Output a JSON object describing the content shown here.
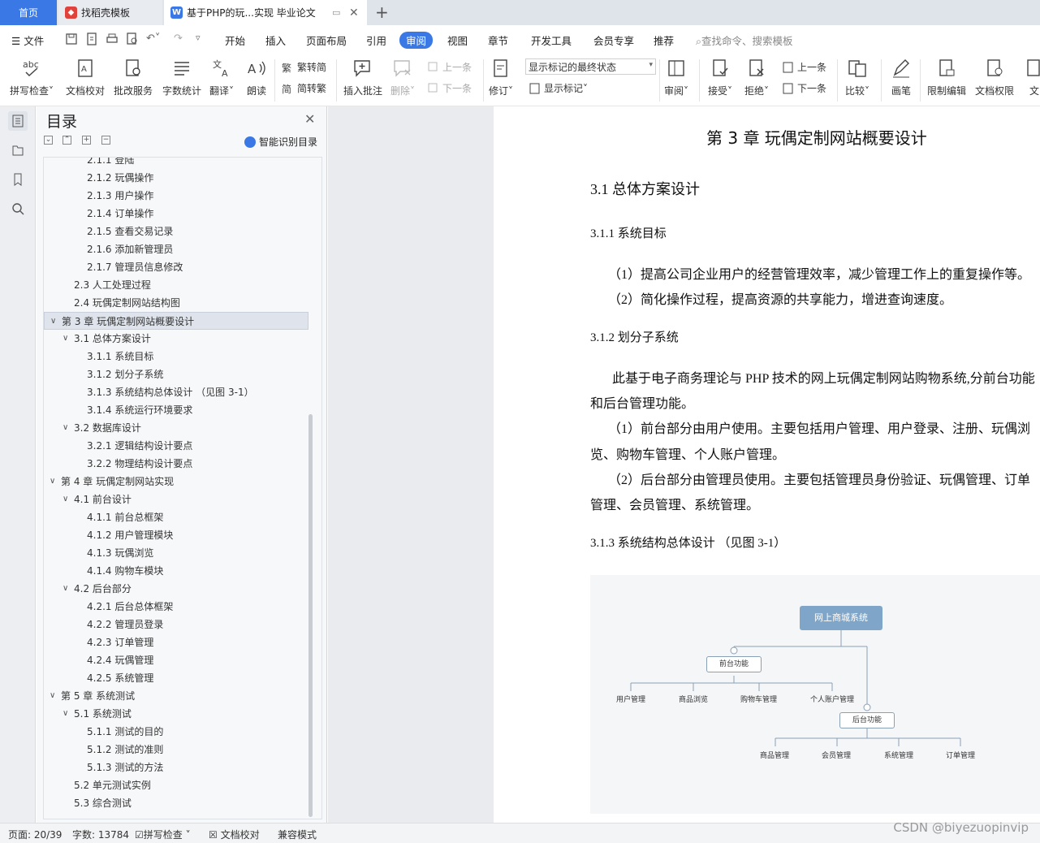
{
  "tabs": [
    {
      "label": "首页"
    },
    {
      "label": "找稻壳模板"
    },
    {
      "label": "基于PHP的玩...实现 毕业论文"
    }
  ],
  "menubar": {
    "file": "文件",
    "items": [
      "开始",
      "插入",
      "页面布局",
      "引用",
      "审阅",
      "视图",
      "章节",
      "开发工具",
      "会员专享",
      "推荐"
    ],
    "active": "审阅",
    "search_placeholder": "查找命令、搜索模板"
  },
  "ribbon": {
    "spell": "拼写检查",
    "proofread": "文档校对",
    "annotate_service": "批改服务",
    "wordcount": "字数统计",
    "translate": "翻译",
    "read_aloud": "朗读",
    "to_traditional": "繁转简",
    "to_simplified": "简转繁",
    "insert_comment": "插入批注",
    "delete": "删除",
    "prev_comment": "上一条",
    "next_comment": "下一条",
    "track": "修订",
    "markup_select": "显示标记的最终状态",
    "show_markup": "显示标记",
    "review": "审阅",
    "accept": "接受",
    "reject": "拒绝",
    "prev_change": "上一条",
    "next_change": "下一条",
    "compare": "比较",
    "pen": "画笔",
    "restrict": "限制编辑",
    "permission": "文档权限",
    "more": "文"
  },
  "nav": {
    "title": "目录",
    "smart": "智能识别目录",
    "items": [
      {
        "label": "2.1.1 登陆",
        "level": 3
      },
      {
        "label": "2.1.2 玩偶操作",
        "level": 3
      },
      {
        "label": "2.1.3 用户操作",
        "level": 3
      },
      {
        "label": "2.1.4 订单操作",
        "level": 3
      },
      {
        "label": "2.1.5 查看交易记录",
        "level": 3
      },
      {
        "label": "2.1.6 添加新管理员",
        "level": 3
      },
      {
        "label": "2.1.7 管理员信息修改",
        "level": 3
      },
      {
        "label": "2.3 人工处理过程",
        "level": 2
      },
      {
        "label": "2.4 玩偶定制网站结构图",
        "level": 2
      },
      {
        "label": "第 3 章  玩偶定制网站概要设计",
        "level": 1,
        "selected": true
      },
      {
        "label": "3.1 总体方案设计",
        "level": 2
      },
      {
        "label": "3.1.1  系统目标",
        "level": 3
      },
      {
        "label": "3.1.2  划分子系统",
        "level": 3
      },
      {
        "label": "3.1.3  系统结构总体设计  （见图 3-1）",
        "level": 3
      },
      {
        "label": "3.1.4  系统运行环境要求",
        "level": 3
      },
      {
        "label": "3.2  数据库设计",
        "level": 2
      },
      {
        "label": "3.2.1 逻辑结构设计要点",
        "level": 3
      },
      {
        "label": "3.2.2 物理结构设计要点",
        "level": 3
      },
      {
        "label": "第 4 章  玩偶定制网站实现",
        "level": 1
      },
      {
        "label": "4.1  前台设计",
        "level": 2
      },
      {
        "label": "4.1.1  前台总框架",
        "level": 3
      },
      {
        "label": "4.1.2  用户管理模块",
        "level": 3
      },
      {
        "label": "4.1.3  玩偶浏览",
        "level": 3
      },
      {
        "label": "4.1.4  购物车模块",
        "level": 3
      },
      {
        "label": "4.2  后台部分",
        "level": 2
      },
      {
        "label": "4.2.1  后台总体框架",
        "level": 3
      },
      {
        "label": "4.2.2  管理员登录",
        "level": 3
      },
      {
        "label": "4.2.3  订单管理",
        "level": 3
      },
      {
        "label": "4.2.4  玩偶管理",
        "level": 3
      },
      {
        "label": "4.2.5  系统管理",
        "level": 3
      },
      {
        "label": "第 5 章  系统测试",
        "level": 1
      },
      {
        "label": "5.1 系统测试",
        "level": 2
      },
      {
        "label": "5.1.1 测试的目的",
        "level": 3
      },
      {
        "label": "5.1.2 测试的准则",
        "level": 3
      },
      {
        "label": "5.1.3 测试的方法",
        "level": 3
      },
      {
        "label": "5.2 单元测试实例",
        "level": 2
      },
      {
        "label": "5.3 综合测试",
        "level": 2
      }
    ]
  },
  "doc": {
    "chapter": "第 3 章  玩偶定制网站概要设计",
    "h2": "3.1 总体方案设计",
    "h3_1": "3.1.1  系统目标",
    "p1": "（1）提高公司企业用户的经营管理效率，减少管理工作上的重复操作等。",
    "p2": "（2）简化操作过程，提高资源的共享能力，增进查询速度。",
    "h3_2": "3.1.2  划分子系统",
    "p3a": "此基于电子商务理论与 PHP 技术的网上玩偶定制网站购物系统,分前台功能",
    "p3b": "和后台管理功能。",
    "p4a": "（1）前台部分由用户使用。主要包括用户管理、用户登录、注册、玩偶浏",
    "p4b": "览、购物车管理、个人账户管理。",
    "p5a": "（2）后台部分由管理员使用。主要包括管理员身份验证、玩偶管理、订单",
    "p5b": "管理、会员管理、系统管理。",
    "h3_3": "3.1.3  系统结构总体设计  （见图 3-1）",
    "diagram": {
      "root": "网上商城系统",
      "front": "前台功能",
      "front_children": [
        "用户管理",
        "商品浏览",
        "购物车管理",
        "个人账户管理"
      ],
      "back": "后台功能",
      "back_children": [
        "商品管理",
        "会员管理",
        "系统管理",
        "订单管理"
      ]
    }
  },
  "status": {
    "page": "页面: 20/39",
    "words": "字数: 13784",
    "spell": "拼写检查",
    "proof": "文档校对",
    "compat": "兼容模式"
  },
  "watermark": "CSDN @biyezuopinvip",
  "colors": {
    "accent": "#3a78e6",
    "diagram_root": "#7fa6c8"
  }
}
